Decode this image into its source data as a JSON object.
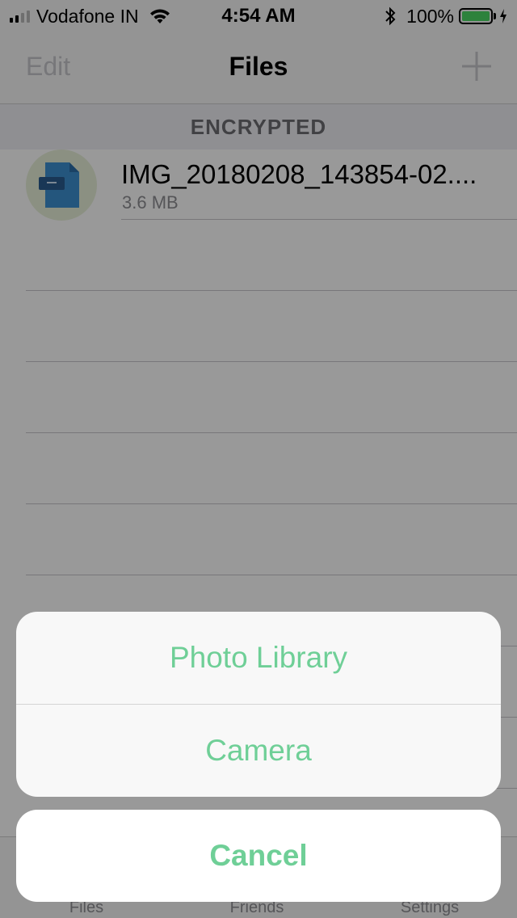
{
  "status_bar": {
    "carrier": "Vodafone IN",
    "time": "4:54 AM",
    "battery_percent": "100%",
    "signal_bars_filled": 2,
    "signal_bars_total": 4
  },
  "nav": {
    "edit_label": "Edit",
    "title": "Files",
    "add_icon": "plus-icon"
  },
  "section": {
    "header": "ENCRYPTED"
  },
  "files": [
    {
      "name": "IMG_20180208_143854-02....",
      "size": "3.6 MB",
      "icon": "file-icon"
    }
  ],
  "tabs": [
    {
      "label": "Files"
    },
    {
      "label": "Friends"
    },
    {
      "label": "Settings"
    }
  ],
  "action_sheet": {
    "options": [
      {
        "label": "Photo Library"
      },
      {
        "label": "Camera"
      }
    ],
    "cancel_label": "Cancel"
  },
  "colors": {
    "accent": "#6fcf97",
    "battery": "#4cd964",
    "file_icon": "#3d8fd1"
  }
}
